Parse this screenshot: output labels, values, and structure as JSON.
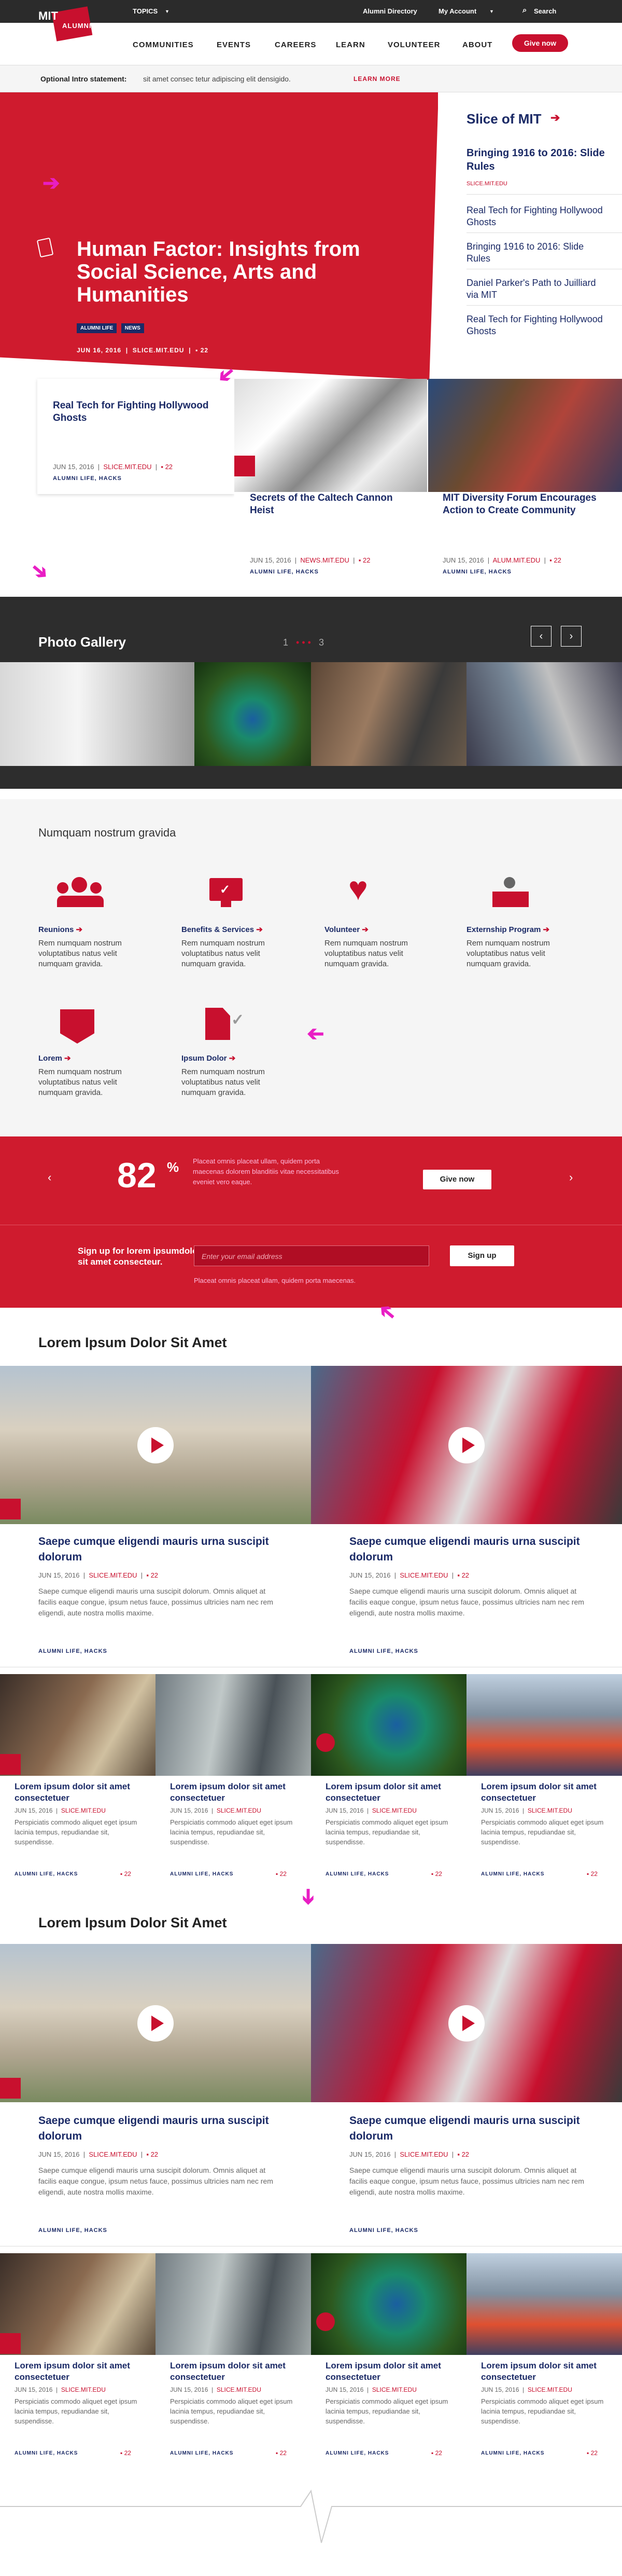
{
  "topbar": {
    "topics": "TOPICS",
    "alumni_directory": "Alumni Directory",
    "my_account": "My Account",
    "search": "Search"
  },
  "logo": {
    "mit": "MIT",
    "alumni": "ALUMNI"
  },
  "nav": {
    "items": [
      "COMMUNITIES",
      "EVENTS",
      "CAREERS",
      "LEARN",
      "VOLUNTEER",
      "ABOUT"
    ],
    "give": "Give now"
  },
  "intro": {
    "label": "Optional Intro statement:",
    "text": "sit amet consec tetur adipiscing elit densigido.",
    "link": "LEARN MORE"
  },
  "hero": {
    "title": "Human Factor: Insights from Social Science, Arts and Humanities",
    "date": "JUN 16, 2016",
    "source": "SLICE.MIT.EDU",
    "comments": "22",
    "tags": [
      "ALUMNI LIFE",
      "NEWS"
    ]
  },
  "slice": {
    "title": "Slice of MIT",
    "items": [
      {
        "title": "Bringing 1916 to 2016: Slide Rules",
        "source": "SLICE.MIT.EDU"
      },
      {
        "title": "Real Tech for Fighting Hollywood Ghosts"
      },
      {
        "title": "Bringing 1916 to 2016: Slide Rules"
      },
      {
        "title": "Daniel Parker's Path to Juilliard via MIT"
      },
      {
        "title": "Real Tech for Fighting Hollywood Ghosts"
      }
    ]
  },
  "cards": [
    {
      "title": "Real Tech for Fighting Hollywood Ghosts",
      "date": "JUN 15, 2016",
      "source": "SLICE.MIT.EDU",
      "comments": "22",
      "cats": "ALUMNI LIFE,  HACKS"
    },
    {
      "title": "Secrets of the Caltech Cannon Heist",
      "date": "JUN 15, 2016",
      "source": "NEWS.MIT.EDU",
      "comments": "22",
      "cats": "ALUMNI LIFE,  HACKS"
    },
    {
      "title": "MIT Diversity Forum Encourages Action to Create Community",
      "date": "JUN 15, 2016",
      "source": "ALUM.MIT.EDU",
      "comments": "22",
      "cats": "ALUMNI LIFE,  HACKS"
    }
  ],
  "gallery": {
    "title": "Photo Gallery",
    "pages": [
      "1",
      "2",
      "3"
    ]
  },
  "services": {
    "title": "Numquam nostrum gravida",
    "items": [
      {
        "label": "Reunions",
        "text": "Rem numquam nostrum voluptatibus natus velit numquam gravida."
      },
      {
        "label": "Benefits & Services",
        "text": "Rem numquam nostrum voluptatibus natus velit numquam gravida."
      },
      {
        "label": "Volunteer",
        "text": "Rem numquam nostrum voluptatibus natus velit numquam gravida."
      },
      {
        "label": "Externship Program",
        "text": "Rem numquam nostrum voluptatibus natus velit numquam gravida."
      },
      {
        "label": "Lorem",
        "text": "Rem numquam nostrum voluptatibus natus velit numquam gravida."
      },
      {
        "label": "Ipsum Dolor",
        "text": "Rem numquam nostrum voluptatibus natus velit numquam gravida."
      }
    ]
  },
  "donate": {
    "percent": "82",
    "percent_sign": "%",
    "text": "Placeat omnis placeat ullam, quidem porta maecenas dolorem blanditiis vitae necessitatibus eveniet vero eaque.",
    "button": "Give now"
  },
  "signup": {
    "title": "Sign up for lorem ipsumdolor sit amet consecteur.",
    "placeholder": "Enter your email address",
    "button": "Sign up",
    "note": "Placeat omnis placeat ullam, quidem porta maecenas."
  },
  "section1": {
    "title": "Lorem Ipsum Dolor Sit Amet"
  },
  "section2": {
    "title": "Lorem Ipsum Dolor Sit Amet"
  },
  "feature": {
    "title": "Saepe cumque eligendi mauris urna suscipit dolorum",
    "date": "JUN 15, 2016",
    "source": "SLICE.MIT.EDU",
    "comments": "22",
    "text": "Saepe cumque eligendi mauris urna suscipit dolorum. Omnis aliquet at facilis eaque congue, ipsum netus fauce, possimus ultricies nam nec rem eligendi, aute nostra mollis maxime.",
    "cats": "ALUMNI LIFE,  HACKS"
  },
  "small": {
    "title": "Lorem ipsum dolor sit amet consectetuer",
    "date": "JUN 15, 2016",
    "source": "SLICE.MIT.EDU",
    "text": "Perspiciatis commodo aliquet eget ipsum lacinia tempus, repudiandae sit, suspendisse.",
    "cats": "ALUMNI LIFE,  HACKS",
    "comments": "22"
  },
  "colors": {
    "brand_red": "#c8102e",
    "navy": "#1b2a66",
    "dark": "#2b2b2b",
    "annotation": "#e91ec4"
  }
}
